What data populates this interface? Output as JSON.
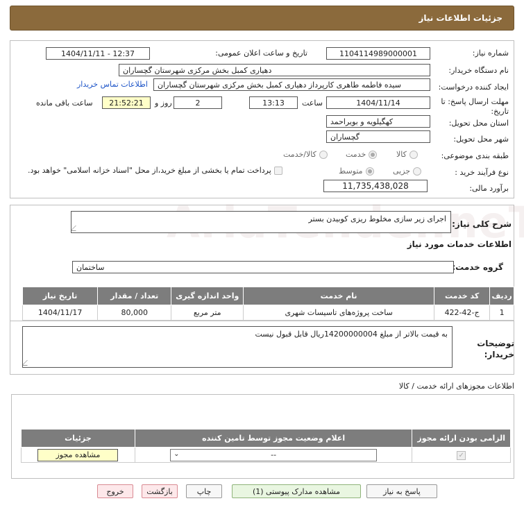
{
  "header": {
    "title": "جزئیات اطلاعات نیاز"
  },
  "form": {
    "need_number_label": "شماره نیاز:",
    "need_number": "1104114989000001",
    "announce_label": "تاریخ و ساعت اعلان عمومی:",
    "announce_value": "1404/11/11 - 12:37",
    "buyer_org_label": "نام دستگاه خریدار:",
    "buyer_org": "دهیاری کمبل بخش مرکزی شهرستان گچساران",
    "creator_label": "ایجاد کننده درخواست:",
    "creator": "سیده فاطمه طاهری کارپرداز دهیاری کمبل بخش مرکزی شهرستان گچساران",
    "contact_link": "اطلاعات تماس خریدار",
    "deadline_label": "مهلت ارسال پاسخ: تا تاریخ:",
    "deadline_date": "1404/11/14",
    "time_label": "ساعت",
    "deadline_time": "13:13",
    "days_value": "2",
    "days_label": "روز و",
    "remaining_time": "21:52:21",
    "remaining_label": "ساعت باقی مانده",
    "province_label": "استان محل تحویل:",
    "province": "کهگیلویه و بویراحمد",
    "city_label": "شهر محل تحویل:",
    "city": "گچساران",
    "category_label": "طبقه بندی موضوعی:",
    "category_options": [
      "کالا",
      "خدمت",
      "کالا/خدمت"
    ],
    "category_selected": "خدمت",
    "process_label": "نوع فرآیند خرید :",
    "process_options": [
      "جزیی",
      "متوسط"
    ],
    "process_selected": "متوسط",
    "payment_note": "پرداخت تمام یا بخشی از مبلغ خرید،از محل \"اسناد خزانه اسلامی\" خواهد بود.",
    "budget_label": "برآورد مالی:",
    "budget": "11,735,438,028"
  },
  "summary": {
    "label": "شرح کلی نیاز:",
    "text": "اجرای زیر سازی مخلوط ریزی کوبیدن بستر"
  },
  "services": {
    "section_title": "اطلاعات خدمات مورد نیاز",
    "group_label": "گروه خدمت:",
    "group_value": "ساختمان",
    "columns": [
      "ردیف",
      "کد خدمت",
      "نام خدمت",
      "واحد اندازه گیری",
      "تعداد / مقدار",
      "تاریخ نیاز"
    ],
    "rows": [
      [
        "1",
        "ج-42-422",
        "ساخت پروژه‌های تاسیسات شهری",
        "متر مربع",
        "80,000",
        "1404/11/17"
      ]
    ]
  },
  "buyer_notes": {
    "label": "توضیحات خریدار:",
    "text": "به قیمت بالاتر از مبلغ 14200000004ریال قابل قبول نیست"
  },
  "permits": {
    "section_title": "اطلاعات مجوزهای ارائه خدمت / کالا",
    "columns": [
      "الزامی بودن ارائه مجوز",
      "اعلام وضعیت مجوز توسط تامین کننده",
      "جزئیات"
    ],
    "select_value": "--",
    "view_button": "مشاهده مجوز"
  },
  "actions": {
    "respond": "پاسخ به نیاز",
    "attachments": "مشاهده مدارک پیوستی (1)",
    "print": "چاپ",
    "back": "بازگشت",
    "exit": "خروج"
  },
  "watermark": {
    "text": "AriaTender.neT"
  },
  "colors": {
    "header": "#8b6a3c",
    "table_header": "#7d7d7d",
    "remaining_bg": "#ffffc8"
  }
}
